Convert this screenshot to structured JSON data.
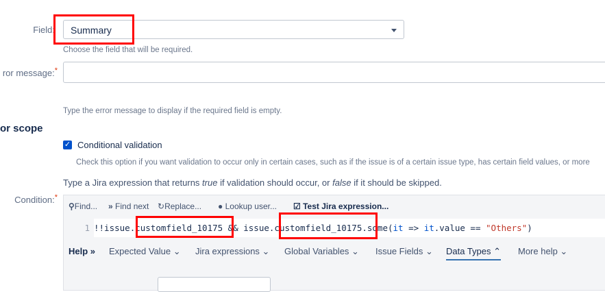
{
  "field": {
    "label": "Field:",
    "value": "Summary",
    "help": "Choose the field that will be required."
  },
  "error_message": {
    "label": "ror message:",
    "required": "*",
    "help": "Type the error message to display if the required field is empty."
  },
  "section": {
    "title": "or scope"
  },
  "conditional": {
    "label": "Conditional validation",
    "checked": true,
    "help": "Check this option if you want validation to occur only in certain cases, such as if the issue is of a certain issue type, has certain field values, or more"
  },
  "expression_intro": {
    "pre": "Type a Jira expression that returns ",
    "true": "true",
    "mid": " if validation should occur, or ",
    "false": "false",
    "post": " if it should be skipped."
  },
  "condition": {
    "label": "Condition:",
    "required": "*"
  },
  "toolbar": {
    "find": "Find...",
    "find_next": "Find next",
    "replace": "Replace...",
    "lookup": "Lookup user...",
    "test": "Test Jira expression..."
  },
  "code": {
    "line": "1",
    "p1": "!!issue",
    "p2": ".customfield_10175",
    "p3": " && issue.",
    "p4": "customfield_10175",
    "p5": ".some(",
    "p6": "it",
    "p7": " => ",
    "p8": "it",
    "p9": ".value == ",
    "p10": "\"Others\"",
    "p11": ")"
  },
  "helpbar": {
    "help": "Help",
    "items": [
      "Expected Value",
      "Jira expressions",
      "Global Variables",
      "Issue Fields",
      "Data Types",
      "More help"
    ],
    "active": "Data Types"
  },
  "colors": {
    "accent": "#0052cc",
    "highlight": "#ff0000"
  }
}
